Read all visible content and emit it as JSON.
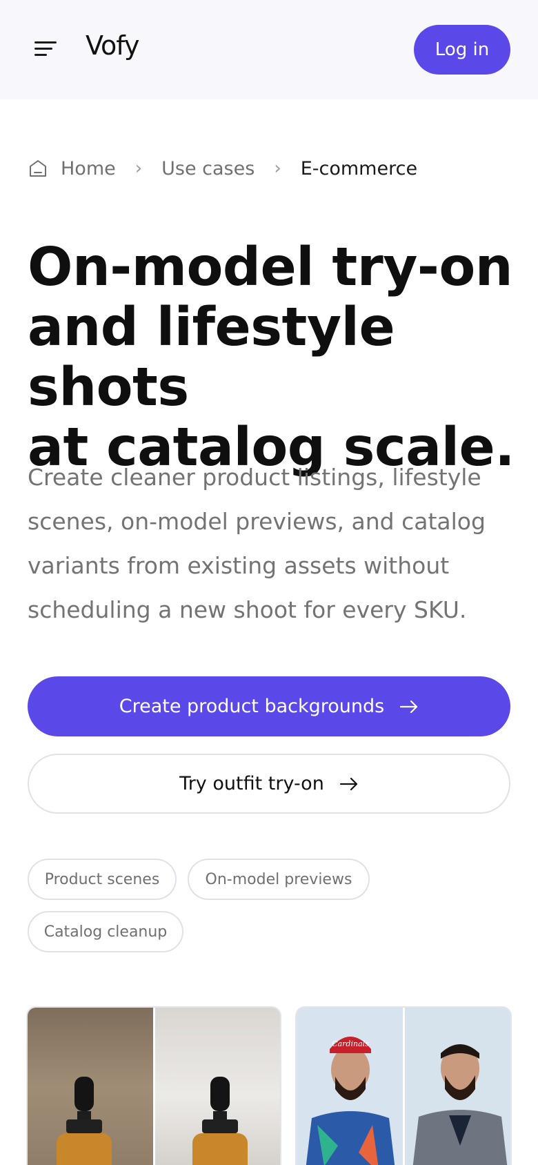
{
  "header": {
    "logo": "Vofy",
    "login_label": "Log in",
    "menu_icon": "menu-icon"
  },
  "breadcrumb": {
    "items": [
      "Home",
      "Use cases",
      "E-commerce"
    ]
  },
  "hero": {
    "headline_lines": [
      "On-model try-on",
      "and lifestyle shots",
      "at catalog scale."
    ],
    "lede_lines": [
      "Create cleaner product listings, lifestyle",
      "scenes, on-model previews, and catalog",
      "variants from existing assets without",
      "scheduling a new shoot for every SKU."
    ]
  },
  "cta": {
    "primary_label": "Create product backgrounds",
    "secondary_label": "Try outfit try-on"
  },
  "chips": [
    "Product scenes",
    "On-model previews",
    "Catalog cleanup"
  ],
  "cards": [
    {
      "name": "serum-bottle-before-after"
    },
    {
      "name": "model-outfit-before-after",
      "cap_text": "Cardinals"
    }
  ],
  "colors": {
    "accent": "#5b48e9",
    "header_bg": "#f8f8fc"
  }
}
